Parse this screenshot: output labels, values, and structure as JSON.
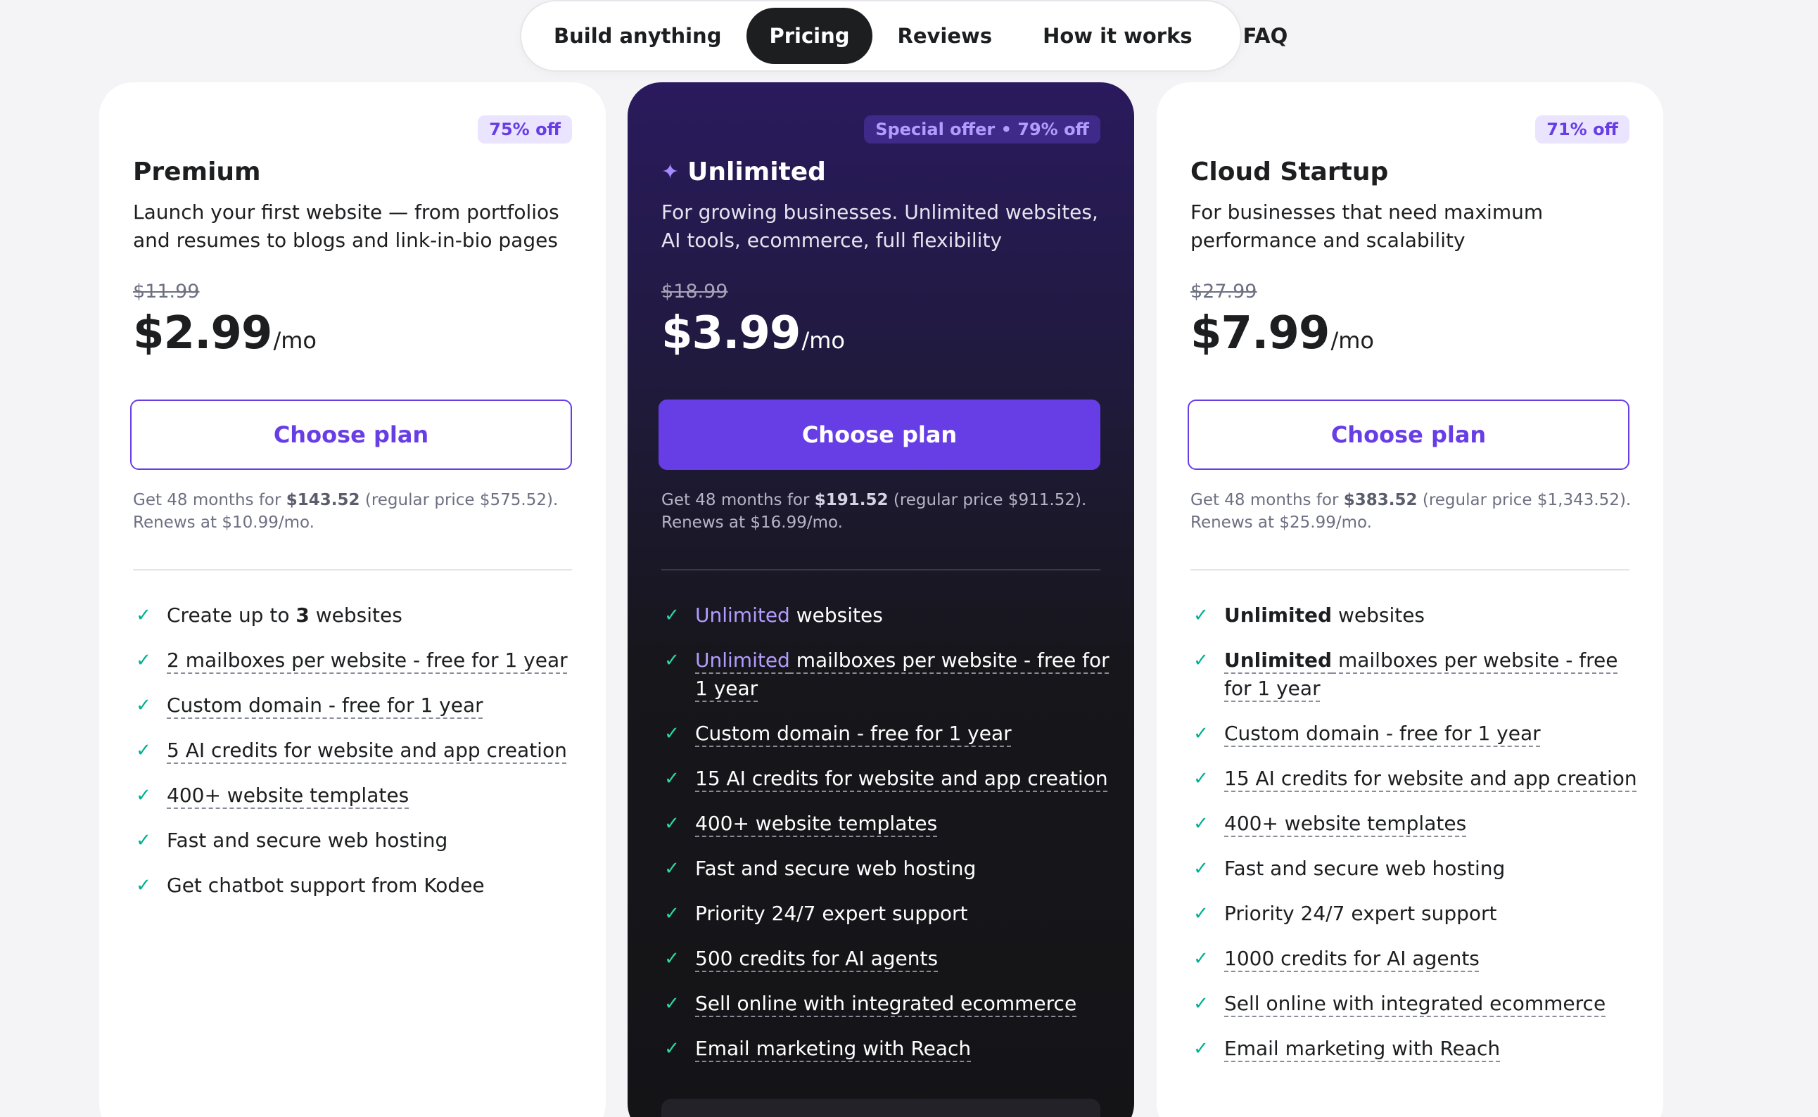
{
  "nav": {
    "items": [
      {
        "label": "Build anything",
        "active": false
      },
      {
        "label": "Pricing",
        "active": true
      },
      {
        "label": "Reviews",
        "active": false
      },
      {
        "label": "How it works",
        "active": false
      },
      {
        "label": "FAQ",
        "active": false
      }
    ]
  },
  "colors": {
    "accent": "#673de6",
    "check": "#00b090",
    "dark_card": "#141417"
  },
  "plans": [
    {
      "badge": "75% off",
      "title": "Premium",
      "description": "Launch your first website — from portfolios and resumes to blogs and link-in-bio pages",
      "old_price": "$11.99",
      "price": "$2.99",
      "unit": "/mo",
      "cta": "Choose plan",
      "terms_pre": "Get 48 months for ",
      "terms_total": "$143.52",
      "terms_post": " (regular price $575.52). Renews at $10.99/mo.",
      "features": [
        {
          "pre": "Create up to ",
          "strong": "3",
          "post": " websites"
        },
        {
          "text": "2 mailboxes per website - free for 1 year"
        },
        {
          "text": "Custom domain - free for 1 year"
        },
        {
          "text": "5 AI credits for website and app creation"
        },
        {
          "text": "400+ website templates"
        },
        {
          "text": "Fast and secure web hosting"
        },
        {
          "text": "Get chatbot support from Kodee"
        }
      ]
    },
    {
      "badge": "Special offer • 79% off",
      "title": "Unlimited",
      "icon": "sparkle-icon",
      "description": "For growing businesses. Unlimited websites, AI tools, ecommerce, full flexibility",
      "old_price": "$18.99",
      "price": "$3.99",
      "unit": "/mo",
      "cta": "Choose plan",
      "terms_pre": "Get 48 months for ",
      "terms_total": "$191.52",
      "terms_post": " (regular price $911.52). Renews at $16.99/mo.",
      "features": [
        {
          "hl": "Unlimited",
          "post": " websites"
        },
        {
          "hl": "Unlimited",
          "post": " mailboxes per website - free for 1 year"
        },
        {
          "text": "Custom domain - free for 1 year"
        },
        {
          "text": "15 AI credits for website and app creation"
        },
        {
          "text": "400+ website templates"
        },
        {
          "text": "Fast and secure web hosting"
        },
        {
          "text": "Priority 24/7 expert support"
        },
        {
          "text": "500 credits for AI agents"
        },
        {
          "text": "Sell online with integrated ecommerce"
        },
        {
          "text": "Email marketing with Reach"
        }
      ]
    },
    {
      "badge": "71% off",
      "title": "Cloud Startup",
      "description": "For businesses that need maximum performance and scalability",
      "old_price": "$27.99",
      "price": "$7.99",
      "unit": "/mo",
      "cta": "Choose plan",
      "terms_pre": "Get 48 months for ",
      "terms_total": "$383.52",
      "terms_post": " (regular price $1,343.52). Renews at $25.99/mo.",
      "features": [
        {
          "strong": "Unlimited",
          "post": " websites"
        },
        {
          "strong": "Unlimited",
          "post": " mailboxes per website - free for 1 year"
        },
        {
          "text": "Custom domain - free for 1 year"
        },
        {
          "text": "15 AI credits for website and app creation"
        },
        {
          "text": "400+ website templates"
        },
        {
          "text": "Fast and secure web hosting"
        },
        {
          "text": "Priority 24/7 expert support"
        },
        {
          "text": "1000 credits for AI agents"
        },
        {
          "text": "Sell online with integrated ecommerce"
        },
        {
          "text": "Email marketing with Reach"
        }
      ]
    }
  ]
}
